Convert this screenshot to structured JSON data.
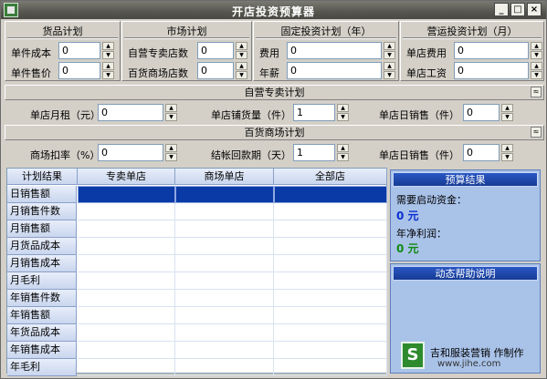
{
  "window": {
    "title": "开店投资预算器",
    "btn_min": "_",
    "btn_max": "□",
    "btn_close": "×"
  },
  "groups": [
    {
      "title": "货品计划",
      "fields": [
        {
          "label": "单件成本",
          "value": "0"
        },
        {
          "label": "单件售价",
          "value": "0"
        }
      ]
    },
    {
      "title": "市场计划",
      "fields": [
        {
          "label": "自营专卖店数",
          "value": "0"
        },
        {
          "label": "百货商场店数",
          "value": "0"
        }
      ]
    },
    {
      "title": "固定投资计划（年）",
      "fields": [
        {
          "label": "费用",
          "value": "0"
        },
        {
          "label": "年薪",
          "value": "0"
        }
      ]
    },
    {
      "title": "营运投资计划（月）",
      "fields": [
        {
          "label": "单店费用",
          "value": "0"
        },
        {
          "label": "单店工资",
          "value": "0"
        }
      ]
    }
  ],
  "self_section": {
    "title": "自营专卖计划",
    "collapse": "≈",
    "fields": [
      {
        "label": "单店月租（元）",
        "value": "0"
      },
      {
        "label": "单店铺货量（件）",
        "value": "1"
      },
      {
        "label": "单店日销售（件）",
        "value": "0"
      }
    ]
  },
  "mall_section": {
    "title": "百货商场计划",
    "collapse": "≈",
    "fields": [
      {
        "label": "商场扣率（%）",
        "value": "0"
      },
      {
        "label": "结帐回款期（天）",
        "value": "1"
      },
      {
        "label": "单店日销售（件）",
        "value": "0"
      }
    ]
  },
  "grid": {
    "corner": "计划结果",
    "columns": [
      "专卖单店",
      "商场单店",
      "全部店"
    ],
    "rows": [
      "日销售额",
      "月销售件数",
      "月销售额",
      "月货品成本",
      "月销售成本",
      "月毛利",
      "年销售件数",
      "年销售额",
      "年货品成本",
      "年销售成本",
      "年毛利"
    ]
  },
  "budget": {
    "title": "预算结果",
    "capital_label": "需要启动资金：",
    "capital_value": "0 元",
    "profit_label": "年净利润：",
    "profit_value": "0 元",
    "colors": {
      "capital": "#0a2fd0",
      "profit": "#118a11",
      "panel": "#a9c2e8"
    }
  },
  "help": {
    "title": "动态帮助说明"
  },
  "credit": {
    "line1": "吉和服装营销",
    "line1b": "作制作",
    "line2": "www.jihe.com",
    "logo": "S"
  }
}
